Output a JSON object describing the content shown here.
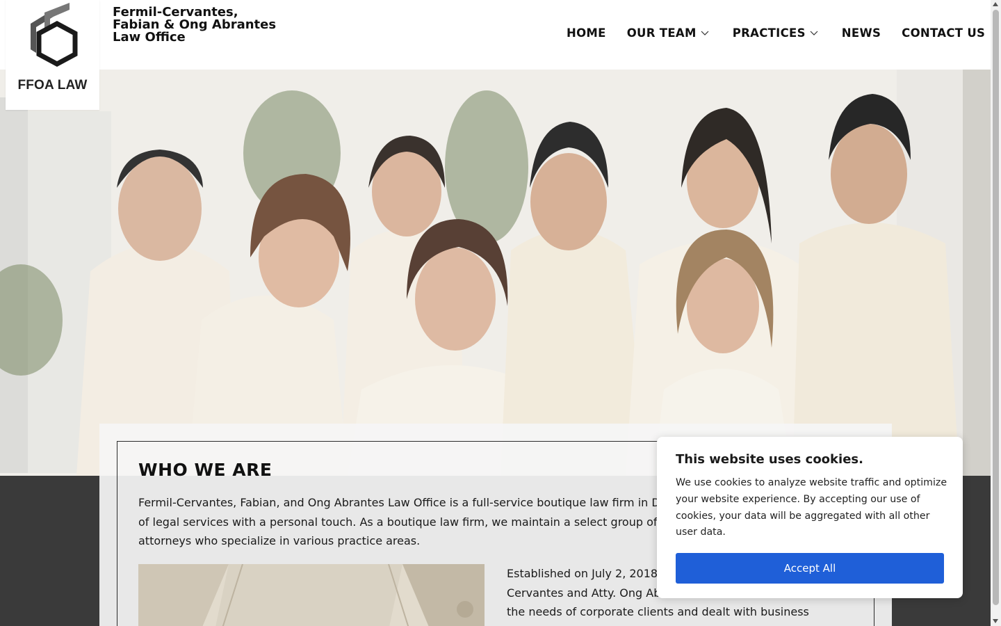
{
  "header": {
    "logo_text": "FFOA LAW",
    "firm_name_lines": [
      "Fermil-Cervantes,",
      "Fabian & Ong Abrantes",
      "Law Office"
    ]
  },
  "nav": {
    "home": "HOME",
    "our_team": "OUR TEAM",
    "practices": "PRACTICES",
    "news": "NEWS",
    "contact_us": "CONTACT US"
  },
  "content": {
    "title": "WHO WE ARE",
    "paragraph_lines": [
      "Fermil-Cervantes, Fabian, and Ong Abrantes Law Office is a full-service boutique law firm in D",
      "of legal services with a personal touch. As a boutique law firm, we maintain a select group of",
      "attorneys who specialize in various practice areas."
    ],
    "paragraph2_lines": [
      "Established on July 2, 2018",
      "Cervantes and Atty. Ong Ab",
      "the needs of corporate clients and dealt with business"
    ]
  },
  "cookie": {
    "title": "This website uses cookies.",
    "body_lines": [
      "We use cookies to analyze website traffic and optimize",
      "your website experience. By accepting our use of",
      "cookies, your data will be aggregated with all other",
      "user data."
    ],
    "accept_label": "Accept All"
  },
  "colors": {
    "accent": "#1f5fd8",
    "dark_band": "#3a3a3a"
  },
  "icons": {
    "dropdown": "chevron-down-icon",
    "logo": "hexagon-logo-icon"
  }
}
